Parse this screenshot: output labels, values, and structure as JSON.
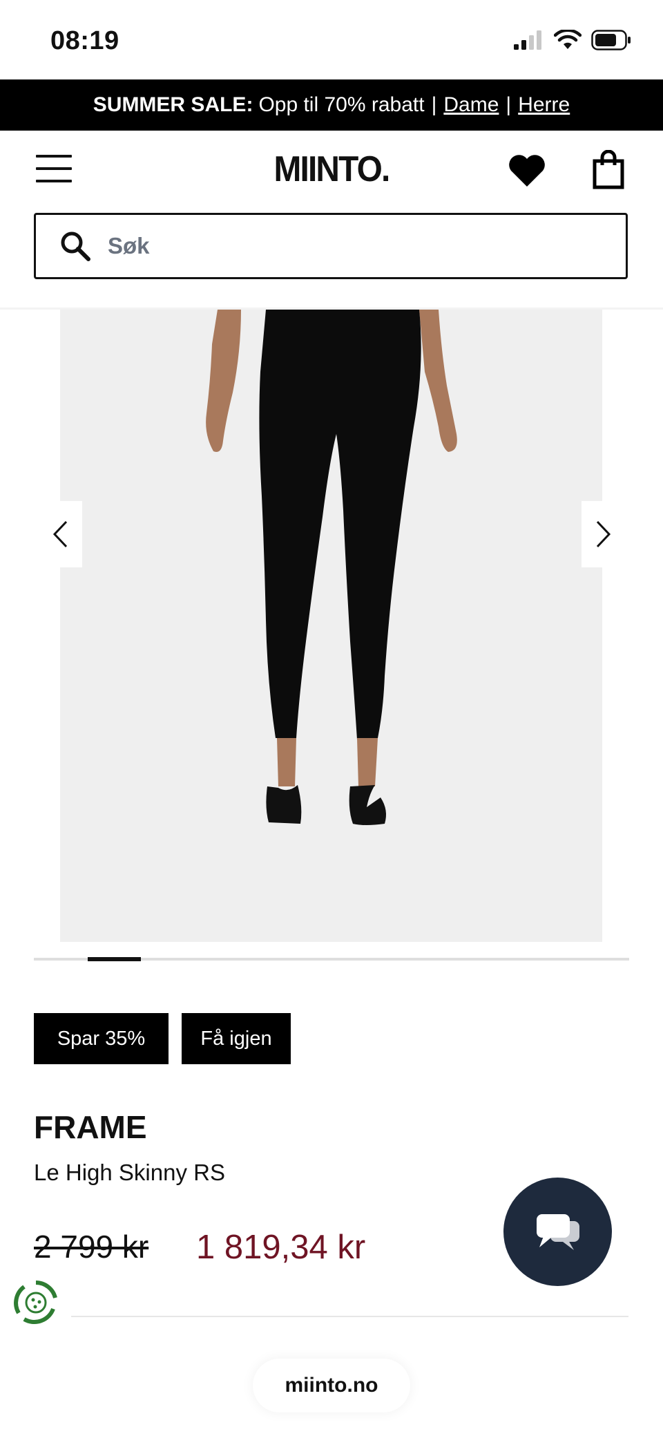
{
  "status_bar": {
    "time": "08:19"
  },
  "promo": {
    "highlight": "SUMMER SALE:",
    "text": "Opp til 70% rabatt",
    "link_women": "Dame",
    "link_men": "Herre"
  },
  "header": {
    "logo": "MIINTO."
  },
  "search": {
    "placeholder": "Søk"
  },
  "carousel": {
    "current_index": 1,
    "progress": 0.09,
    "image_background": "#efefef"
  },
  "tags": {
    "discount": "Spar 35%",
    "cashback": "Få igjen"
  },
  "product": {
    "brand": "FRAME",
    "name": "Le High Skinny RS",
    "price_old": "2 799 kr",
    "price_new": "1 819,34 kr"
  },
  "colors": {
    "sale_price": "#6f1424",
    "chat_button": "#1e2a3d",
    "cookie_icon": "#2e7d32"
  },
  "browser": {
    "url": "miinto.no"
  },
  "icons": [
    "signal-icon",
    "wifi-icon",
    "battery-icon",
    "menu-icon",
    "heart-icon",
    "shopping-bag-icon",
    "search-icon",
    "chevron-left-icon",
    "chevron-right-icon",
    "chat-icon",
    "cookie-settings-icon"
  ]
}
